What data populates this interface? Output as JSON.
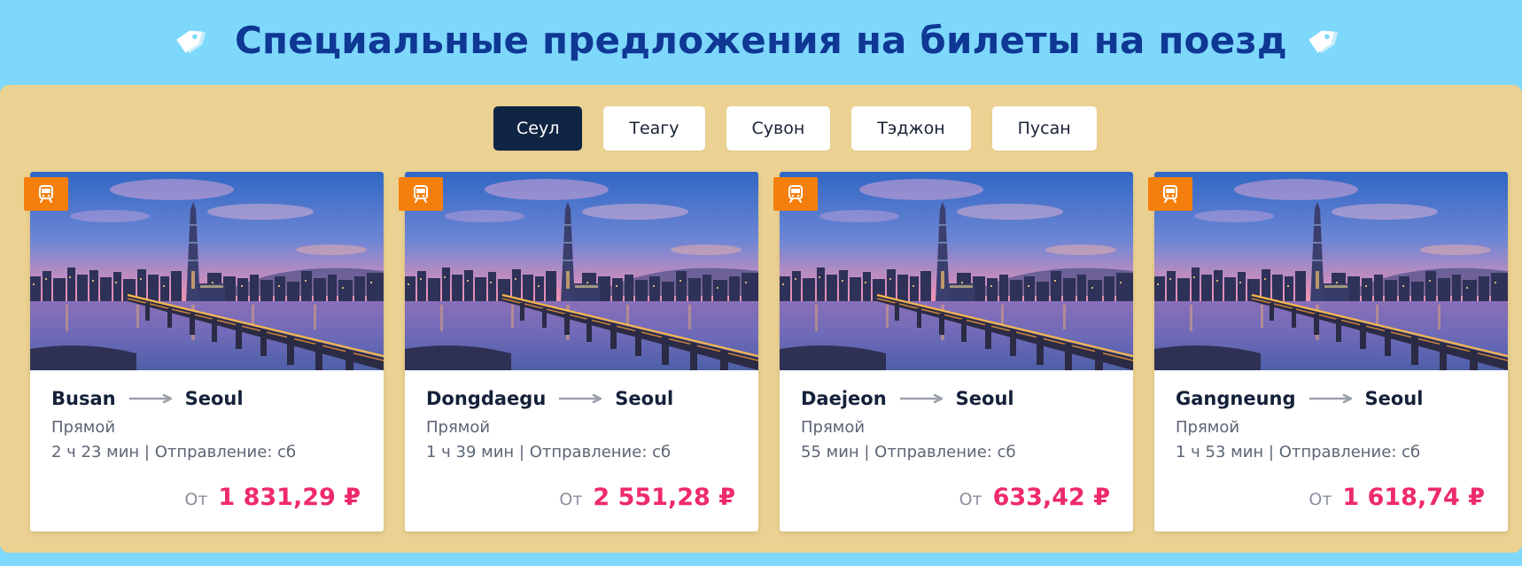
{
  "header": {
    "title": "Специальные предложения на билеты на поезд",
    "left_icon": "price-tag-icon",
    "right_icon": "price-tag-icon"
  },
  "tabs": [
    {
      "label": "Сеул",
      "active": true
    },
    {
      "label": "Теагу",
      "active": false
    },
    {
      "label": "Сувон",
      "active": false
    },
    {
      "label": "Тэджон",
      "active": false
    },
    {
      "label": "Пусан",
      "active": false
    }
  ],
  "cards": [
    {
      "from": "Busan",
      "to": "Seoul",
      "type": "Прямой",
      "details": "2 ч 23 мин | Отправление: сб",
      "from_label": "От",
      "price": "1 831,29 ₽",
      "badge_icon": "train-icon"
    },
    {
      "from": "Dongdaegu",
      "to": "Seoul",
      "type": "Прямой",
      "details": "1 ч 39 мин | Отправление: сб",
      "from_label": "От",
      "price": "2 551,28 ₽",
      "badge_icon": "train-icon"
    },
    {
      "from": "Daejeon",
      "to": "Seoul",
      "type": "Прямой",
      "details": "55 мин | Отправление: сб",
      "from_label": "От",
      "price": "633,42 ₽",
      "badge_icon": "train-icon"
    },
    {
      "from": "Gangneung",
      "to": "Seoul",
      "type": "Прямой",
      "details": "1 ч 53 мин | Отправление: сб",
      "from_label": "От",
      "price": "1 618,74 ₽",
      "badge_icon": "train-icon"
    }
  ],
  "colors": {
    "page_background": "#7dd8fb",
    "panel_background": "#ecd292",
    "title": "#0f3794",
    "active_tab": "#102443",
    "badge": "#f57f0c",
    "price": "#ee2a6b"
  }
}
